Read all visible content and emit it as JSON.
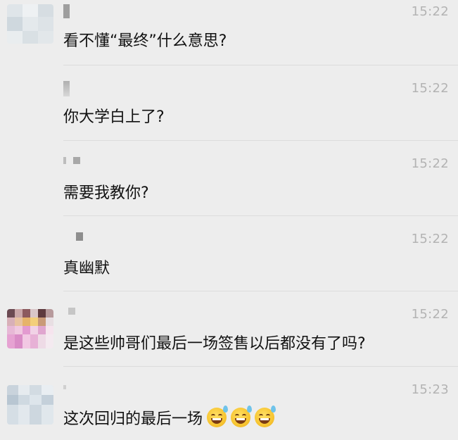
{
  "messages": [
    {
      "time": "15:22",
      "text": "看不懂“最终”什么意思?"
    },
    {
      "time": "15:22",
      "text": "你大学白上了?"
    },
    {
      "time": "15:22",
      "text": "需要我教你?"
    },
    {
      "time": "15:22",
      "text": "真幽默"
    },
    {
      "time": "15:22",
      "text": "是这些帅哥们最后一场签售以后都没有了吗?"
    },
    {
      "time": "15:23",
      "text": "这次回归的最后一场",
      "emoji": [
        "sweat-smile-icon",
        "sweat-smile-icon",
        "sweat-smile-icon"
      ]
    }
  ],
  "colors": {
    "background": "#ededed",
    "timestamp": "#b3b3b3",
    "message_text": "#111111",
    "divider": "#dcdcdc"
  }
}
